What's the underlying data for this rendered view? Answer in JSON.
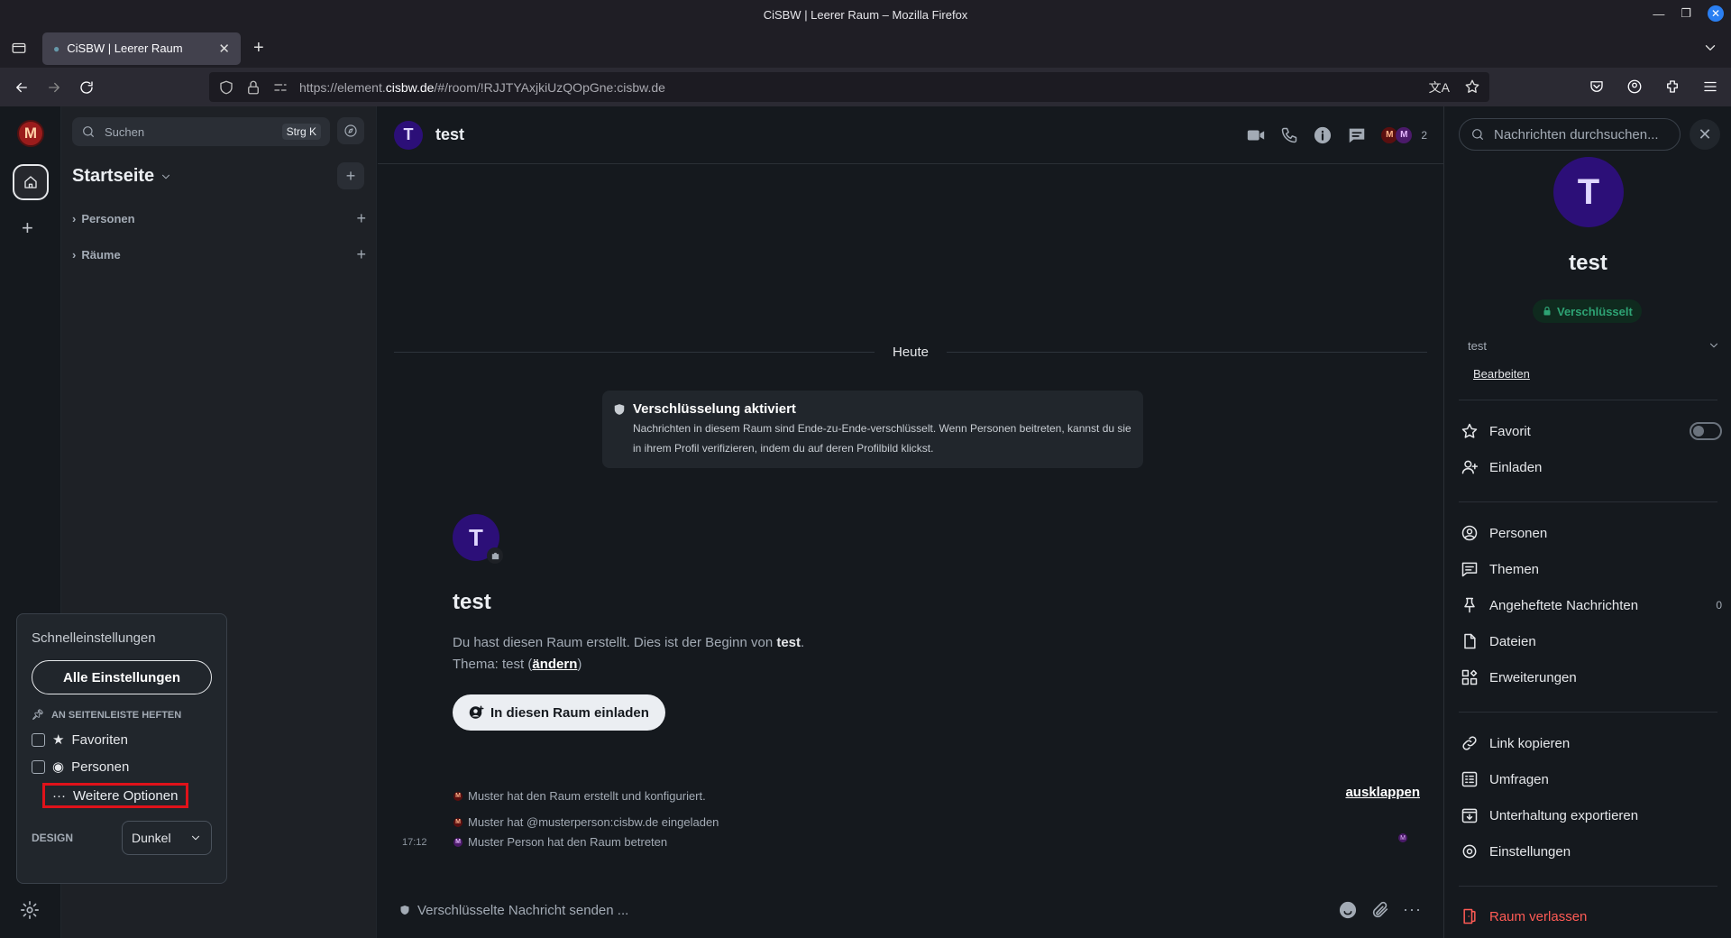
{
  "browser": {
    "window_title": "CiSBW | Leerer Raum – Mozilla Firefox",
    "tab_title": "CiSBW | Leerer Raum",
    "url_prefix": "https://element.",
    "url_domain": "cisbw.de",
    "url_rest": "/#/room/!RJJTYAxjkiUzQOpGne:cisbw.de"
  },
  "spaces": {
    "user_initial": "M"
  },
  "roomlist": {
    "search_placeholder": "Suchen",
    "search_shortcut": "Strg K",
    "home_title": "Startseite",
    "sections": [
      "Personen",
      "Räume"
    ]
  },
  "quick_settings": {
    "title": "Schnelleinstellungen",
    "all_settings": "Alle Einstellungen",
    "pin_heading": "AN SEITENLEISTE HEFTEN",
    "options": [
      "Favoriten",
      "Personen"
    ],
    "more_options": "Weitere Optionen",
    "design_label": "DESIGN",
    "design_value": "Dunkel"
  },
  "room": {
    "initial": "T",
    "name": "test",
    "member_count": "2",
    "day_separator": "Heute",
    "encryption_title": "Verschlüsselung aktiviert",
    "encryption_text": "Nachrichten in diesem Raum sind Ende-zu-Ende-verschlüsselt. Wenn Personen beitreten, kannst du sie in ihrem Profil verifizieren, indem du auf deren Profilbild klickst.",
    "intro_prefix": "Du hast diesen Raum erstellt. Dies ist der Beginn von ",
    "intro_room": "test",
    "intro_suffix": ".",
    "topic_prefix": "Thema: test (",
    "topic_link": "ändern",
    "topic_suffix": ")",
    "invite_button": "In diesen Raum einladen",
    "events": [
      "Muster hat den Raum erstellt und konfiguriert.",
      "Muster hat @musterperson:cisbw.de eingeladen",
      "Muster Person hat den Raum betreten"
    ],
    "expand_label": "ausklappen",
    "event_time": "17:12",
    "composer_placeholder": "Verschlüsselte Nachricht senden ..."
  },
  "right_panel": {
    "search_placeholder": "Nachrichten durchsuchen...",
    "room_name": "test",
    "encrypted_badge": "Verschlüsselt",
    "topic": "test",
    "edit_link": "Bearbeiten",
    "items": {
      "favorite": "Favorit",
      "invite": "Einladen",
      "people": "Personen",
      "threads": "Themen",
      "pinned": "Angeheftete Nachrichten",
      "pinned_count": "0",
      "files": "Dateien",
      "extensions": "Erweiterungen",
      "copy_link": "Link kopieren",
      "polls": "Umfragen",
      "export": "Unterhaltung exportieren",
      "settings": "Einstellungen",
      "leave": "Raum verlassen"
    }
  },
  "colors": {
    "accent_red": "#e0121a",
    "avatar_purple": "#2c0f78",
    "encrypted_green": "#2ea374",
    "danger": "#ff5b55"
  }
}
